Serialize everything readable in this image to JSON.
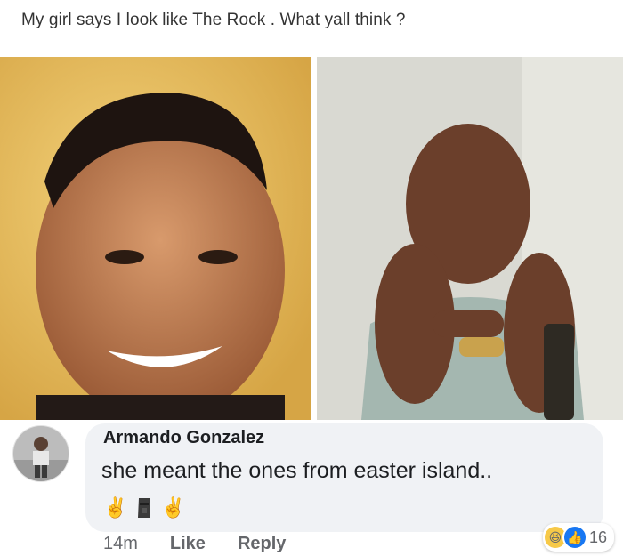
{
  "post": {
    "caption": "My girl says I look like The Rock . What yall think ?"
  },
  "comment": {
    "author": "Armando Gonzalez",
    "text": "she meant the ones from easter island..",
    "emojis": [
      "victory-hand",
      "moai",
      "victory-hand"
    ],
    "timestamp": "14m",
    "like_label": "Like",
    "reply_label": "Reply",
    "reaction_count": "16",
    "reaction_icons": [
      "haha-reaction",
      "like-reaction"
    ]
  },
  "colors": {
    "bubble": "#f0f2f5",
    "text": "#1c1e21",
    "meta": "#65676b",
    "like_blue": "#1877f2"
  }
}
